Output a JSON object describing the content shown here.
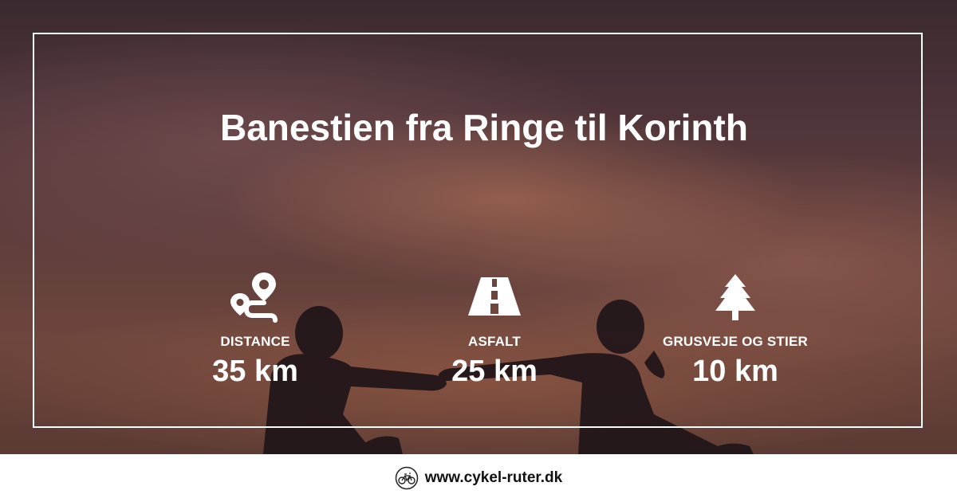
{
  "title": "Banestien fra Ringe til Korinth",
  "stats": [
    {
      "label": "DISTANCE",
      "value": "35 km",
      "icon": "route-icon"
    },
    {
      "label": "ASFALT",
      "value": "25 km",
      "icon": "road-icon"
    },
    {
      "label": "GRUSVEJE OG STIER",
      "value": "10 km",
      "icon": "pine-tree-icon"
    }
  ],
  "footer": {
    "site": "www.cykel-ruter.dk",
    "icon": "bicycle-logo-icon"
  },
  "colors": {
    "text": "#ffffff",
    "frame": "#ffffff",
    "footer_bg": "#ffffff",
    "footer_text": "#111111"
  }
}
